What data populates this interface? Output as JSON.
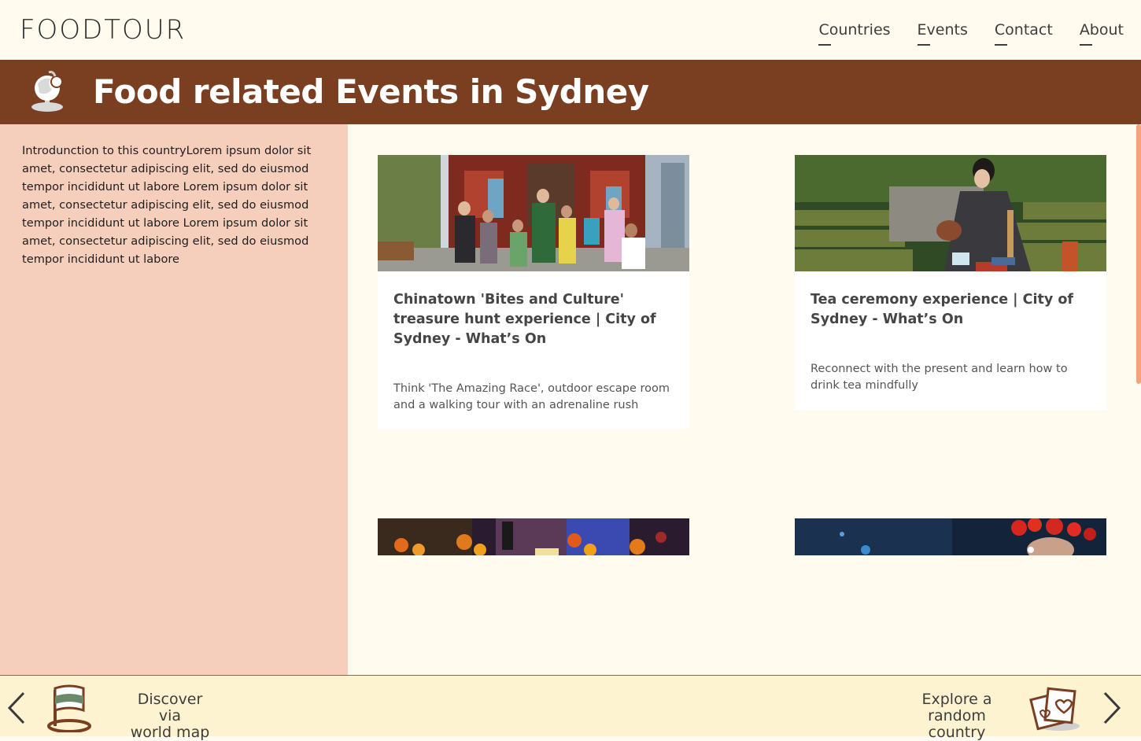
{
  "header": {
    "logo": "FOODTOUR",
    "nav": [
      "Countries",
      "Events",
      "Contact",
      "About"
    ]
  },
  "banner": {
    "title": "Food related Events in Sydney",
    "icon": "globe-food-icon"
  },
  "sidebar": {
    "intro": "Introdunction to this countryLorem ipsum dolor sit amet, consectetur adipiscing elit, sed do eiusmod tempor incididunt ut labore Lorem ipsum dolor sit amet, consectetur adipiscing elit, sed do eiusmod tempor incididunt ut labore Lorem ipsum dolor sit amet, consectetur adipiscing elit, sed do eiusmod tempor incididunt ut labore"
  },
  "events": [
    {
      "title": "Chinatown 'Bites and Culture' treasure hunt experience | City of Sydney - What’s On",
      "description": "Think 'The Amazing Race', outdoor escape room and a walking tour with an adrenaline rush"
    },
    {
      "title": "Tea ceremony experience | City of Sydney - What’s On",
      "description": "Reconnect with the present and learn how to drink tea mindfully"
    }
  ],
  "footer": {
    "left_line1": "Discover via",
    "left_line2": "world map",
    "right_line1": "Explore a",
    "right_line2": "random country"
  },
  "colors": {
    "banner": "#7a3e20",
    "sidebar": "#f5cfbc",
    "page": "#fffcef",
    "footer": "#fdf3d0"
  }
}
